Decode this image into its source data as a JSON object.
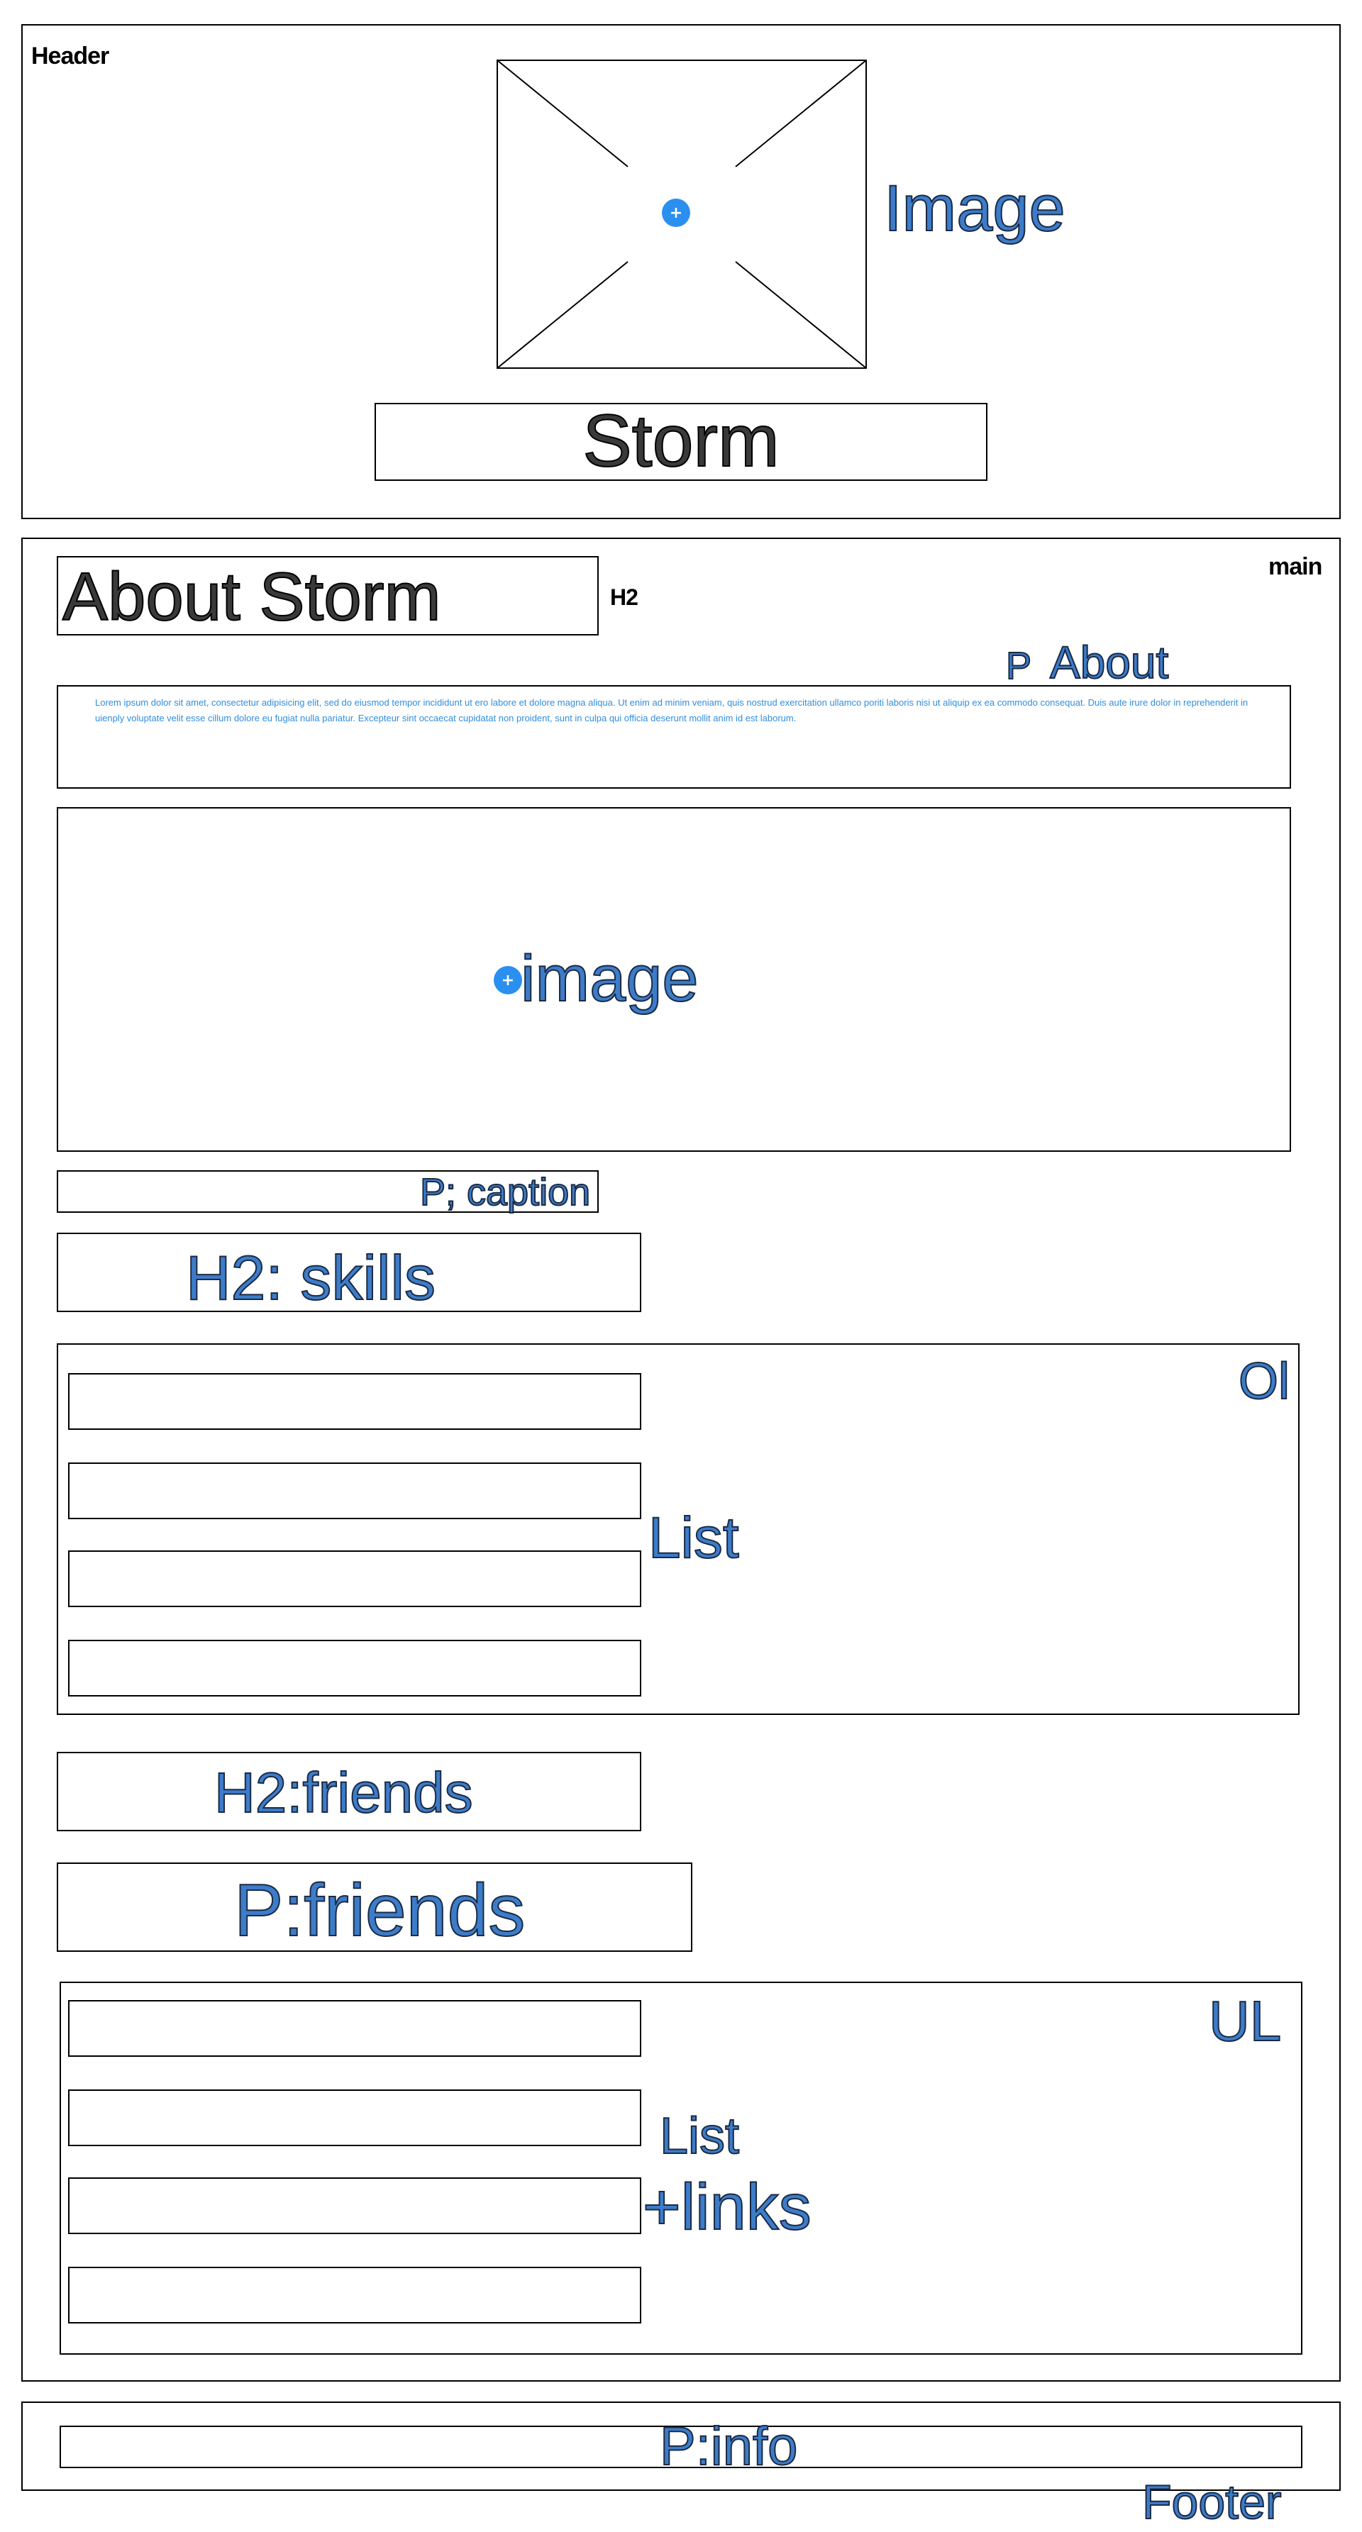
{
  "header": {
    "label": "Header",
    "image_label": "Image",
    "image_icon": "plus-icon",
    "title": "Storm"
  },
  "main": {
    "label": "main",
    "h2_box_text": "About Storm",
    "h2_tag": "H2",
    "p_about_tag": "P",
    "p_about_label": "About",
    "lorem": "Lorem ipsum dolor sit amet, consectetur adipisicing elit, sed do eiusmod tempor incididunt ut ero labore et dolore magna aliqua. Ut enim ad minim veniam, quis nostrud exercitation ullamco poriti laboris nisi ut aliquip ex ea commodo consequat. Duis aute irure dolor in reprehenderit in uienply voluptate velit esse cillum dolore eu fugiat nulla pariatur. Excepteur sint occaecat cupidatat non proident, sunt in culpa qui officia deserunt mollit anim id est laborum.",
    "image_label": "image",
    "image_icon": "plus-icon",
    "caption": "P; caption",
    "skills_heading": "H2: skills",
    "ol_tag": "Ol",
    "ol_list_label": "List",
    "friends_heading": "H2:friends",
    "friends_p": "P:friends",
    "ul_tag": "UL",
    "ul_list_label": "List",
    "ul_links_label": "+links"
  },
  "footer": {
    "info": "P:info",
    "label": "Footer"
  },
  "colors": {
    "accent_blue": "#3c7cc9",
    "plus_dot": "#2b8ff0",
    "lorem_text": "#2f8ee0"
  }
}
